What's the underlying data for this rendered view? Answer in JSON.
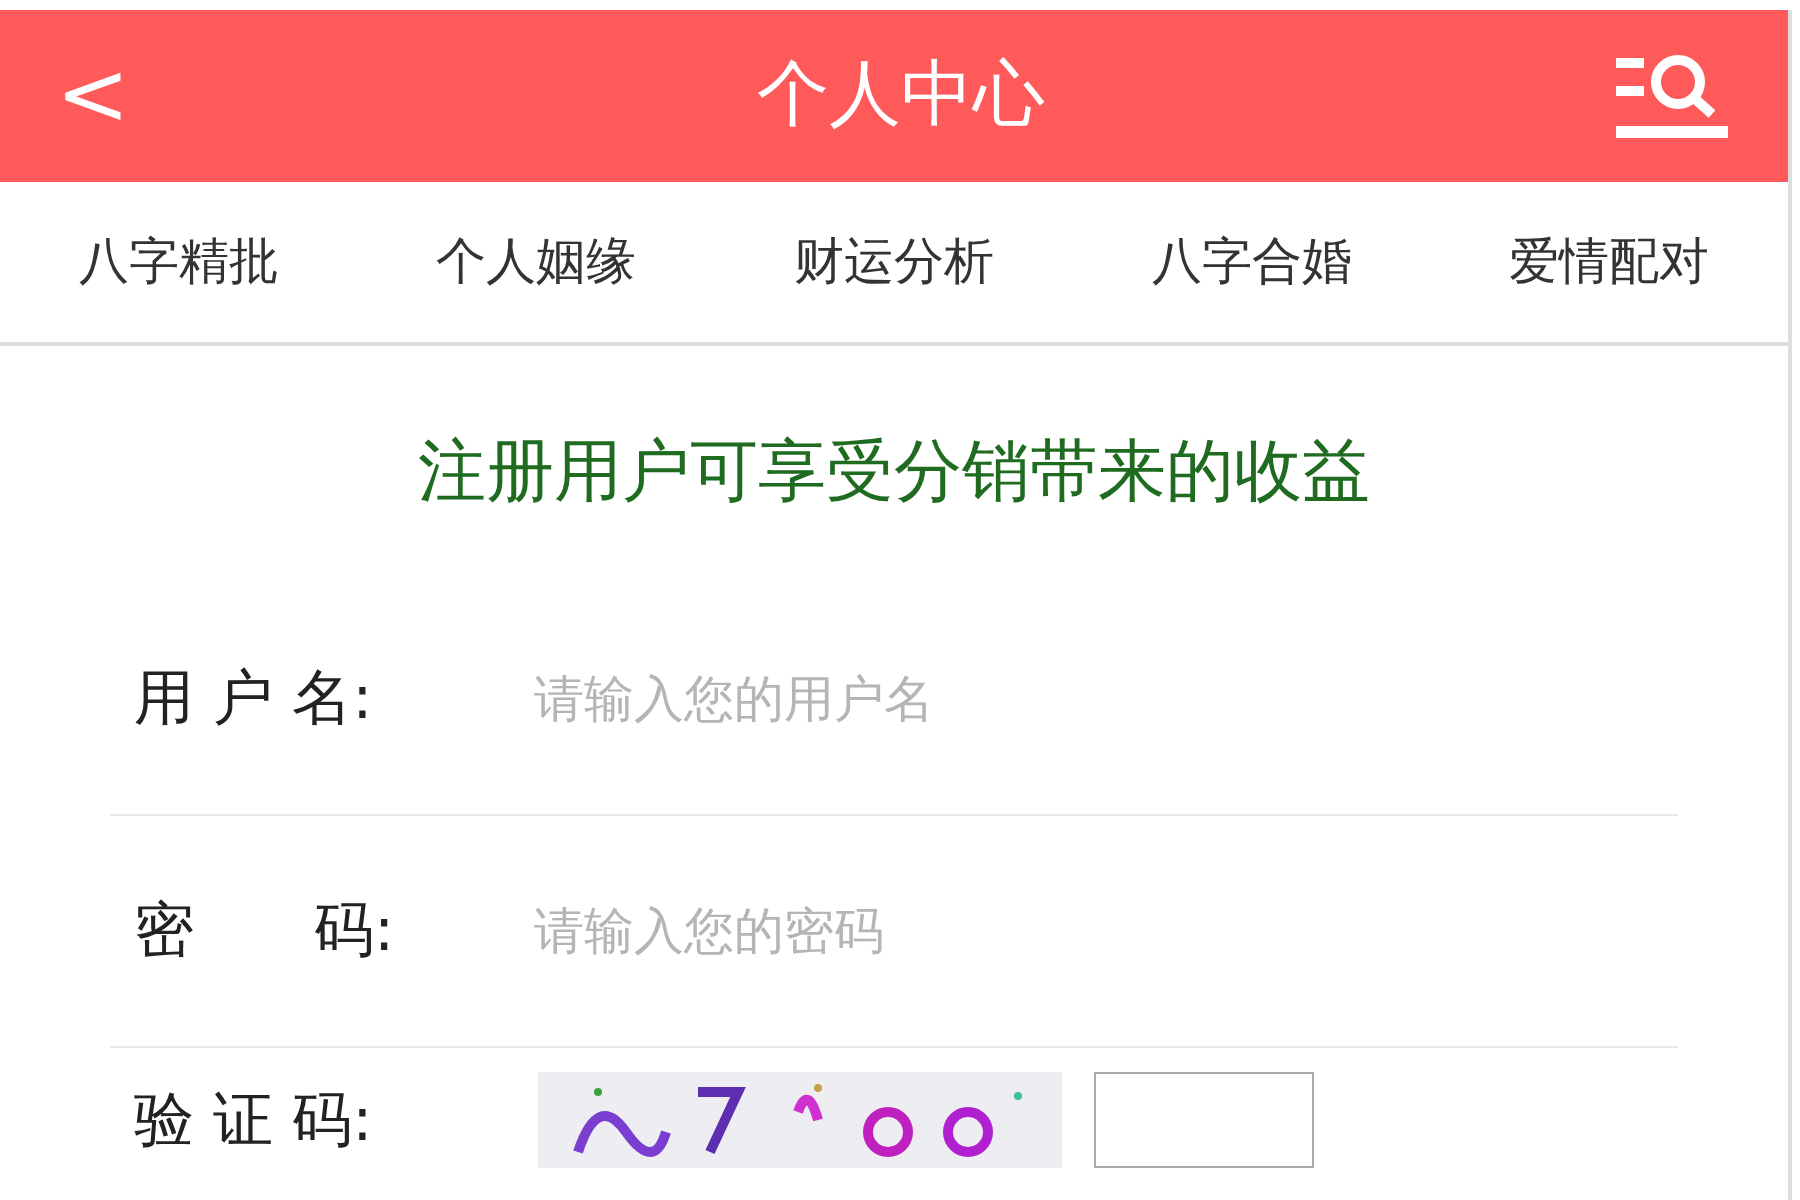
{
  "header": {
    "back": "<",
    "title": "个人中心"
  },
  "nav": [
    {
      "label": "八字精批"
    },
    {
      "label": "个人姻缘"
    },
    {
      "label": "财运分析"
    },
    {
      "label": "八字合婚"
    },
    {
      "label": "爱情配对"
    }
  ],
  "headline": "注册用户可享受分销带来的收益",
  "form": [
    {
      "kind": "text",
      "label": "用 户 名:",
      "placeholder": "请输入您的用户名"
    },
    {
      "kind": "text",
      "label": "密　　码:",
      "placeholder": "请输入您的密码"
    },
    {
      "kind": "captcha",
      "label": "验 证 码:"
    }
  ]
}
